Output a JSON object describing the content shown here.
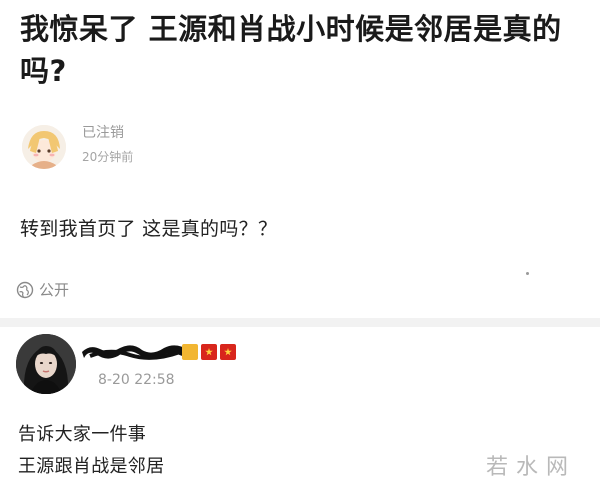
{
  "post": {
    "title": "我惊呆了 王源和肖战小时候是邻居是真的吗?",
    "author": {
      "name": "已注销",
      "time": "20分钟前"
    },
    "body": "转到我首页了 这是真的吗？？",
    "visibility_label": "公开",
    "visibility_icon": "globe-icon"
  },
  "comment": {
    "time": "8-20 22:58",
    "lines": [
      "告诉大家一件事",
      "王源跟肖战是邻居"
    ],
    "badge_colors": [
      "#f2b632",
      "#d8261c",
      "#d8261c"
    ]
  },
  "watermark": {
    "text": "若水网"
  }
}
